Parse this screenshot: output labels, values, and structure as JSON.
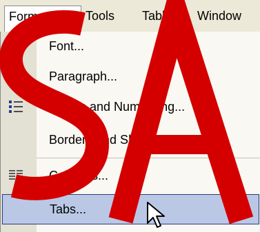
{
  "menubar": {
    "items": [
      {
        "label": "Format",
        "active": true
      },
      {
        "label": "Tools"
      },
      {
        "label": "Table"
      },
      {
        "label": "Window"
      }
    ]
  },
  "menu": {
    "items": [
      {
        "label": "Font...",
        "icon": "font-a-icon"
      },
      {
        "label": "Paragraph...",
        "icon": "paragraph-icon"
      },
      {
        "label": "Bullets and Numbering...",
        "icon": "bullets-icon"
      },
      {
        "label": "Borders and Shading...",
        "icon": null
      },
      {
        "label": "Columns...",
        "icon": "columns-icon"
      },
      {
        "label": "Tabs...",
        "icon": null,
        "highlighted": true
      }
    ]
  },
  "watermark": {
    "text": "SA",
    "color": "#cc0000"
  },
  "colors": {
    "menubar_bg": "#ece9d8",
    "menu_bg": "#f9f8f3",
    "icon_strip": "#e3e0d4",
    "highlight_bg": "#bac8e6",
    "highlight_border": "#2a3a7a"
  }
}
